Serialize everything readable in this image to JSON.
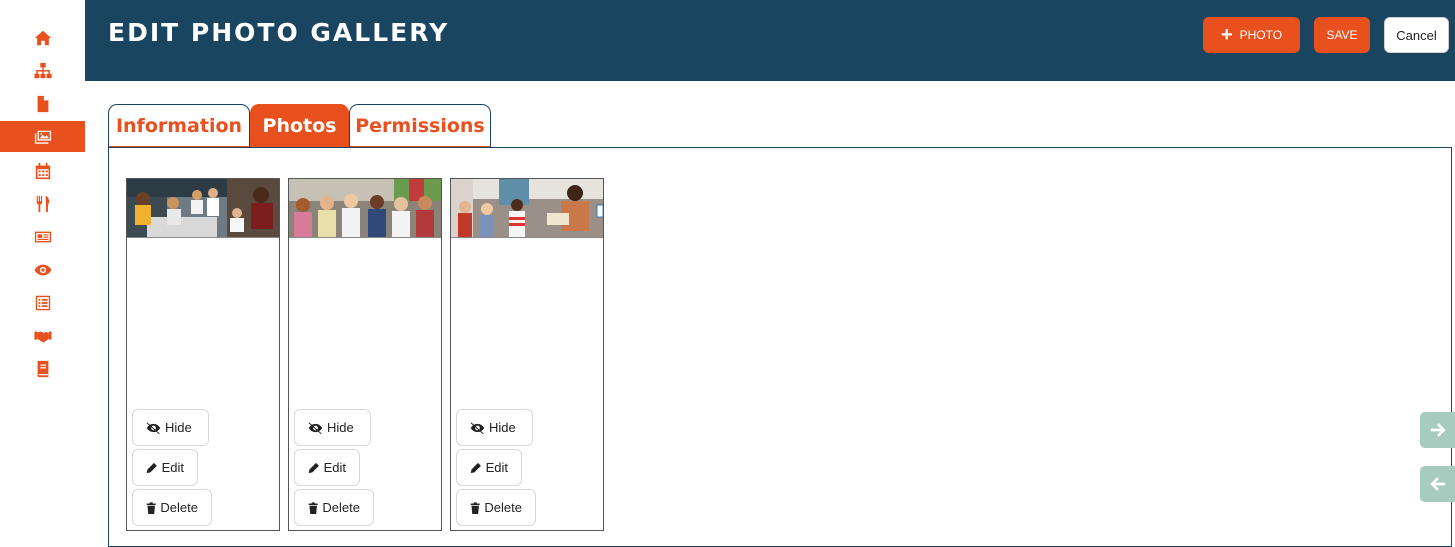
{
  "sidebar": {
    "items": [
      {
        "icon": "home-icon"
      },
      {
        "icon": "sitemap-icon"
      },
      {
        "icon": "file-icon"
      },
      {
        "icon": "images-icon",
        "active": true
      },
      {
        "icon": "calendar-icon"
      },
      {
        "icon": "utensils-icon"
      },
      {
        "icon": "newspaper-icon"
      },
      {
        "icon": "eye-icon"
      },
      {
        "icon": "list-icon"
      },
      {
        "icon": "handshake-icon"
      },
      {
        "icon": "book-icon"
      }
    ]
  },
  "header": {
    "title": "EDIT PHOTO GALLERY",
    "add_photo_label": "PHOTO",
    "save_label": "SAVE",
    "cancel_label": "Cancel"
  },
  "tabs": [
    {
      "label": "Information"
    },
    {
      "label": "Photos",
      "active": true
    },
    {
      "label": "Permissions"
    }
  ],
  "photos": [
    {
      "hide_label": "Hide",
      "edit_label": "Edit",
      "delete_label": "Delete"
    },
    {
      "hide_label": "Hide",
      "edit_label": "Edit",
      "delete_label": "Delete"
    },
    {
      "hide_label": "Hide",
      "edit_label": "Edit",
      "delete_label": "Delete"
    }
  ],
  "colors": {
    "accent": "#e8501d",
    "header_bg": "#1a4560",
    "arrow_bg": "#a8cbbf"
  }
}
